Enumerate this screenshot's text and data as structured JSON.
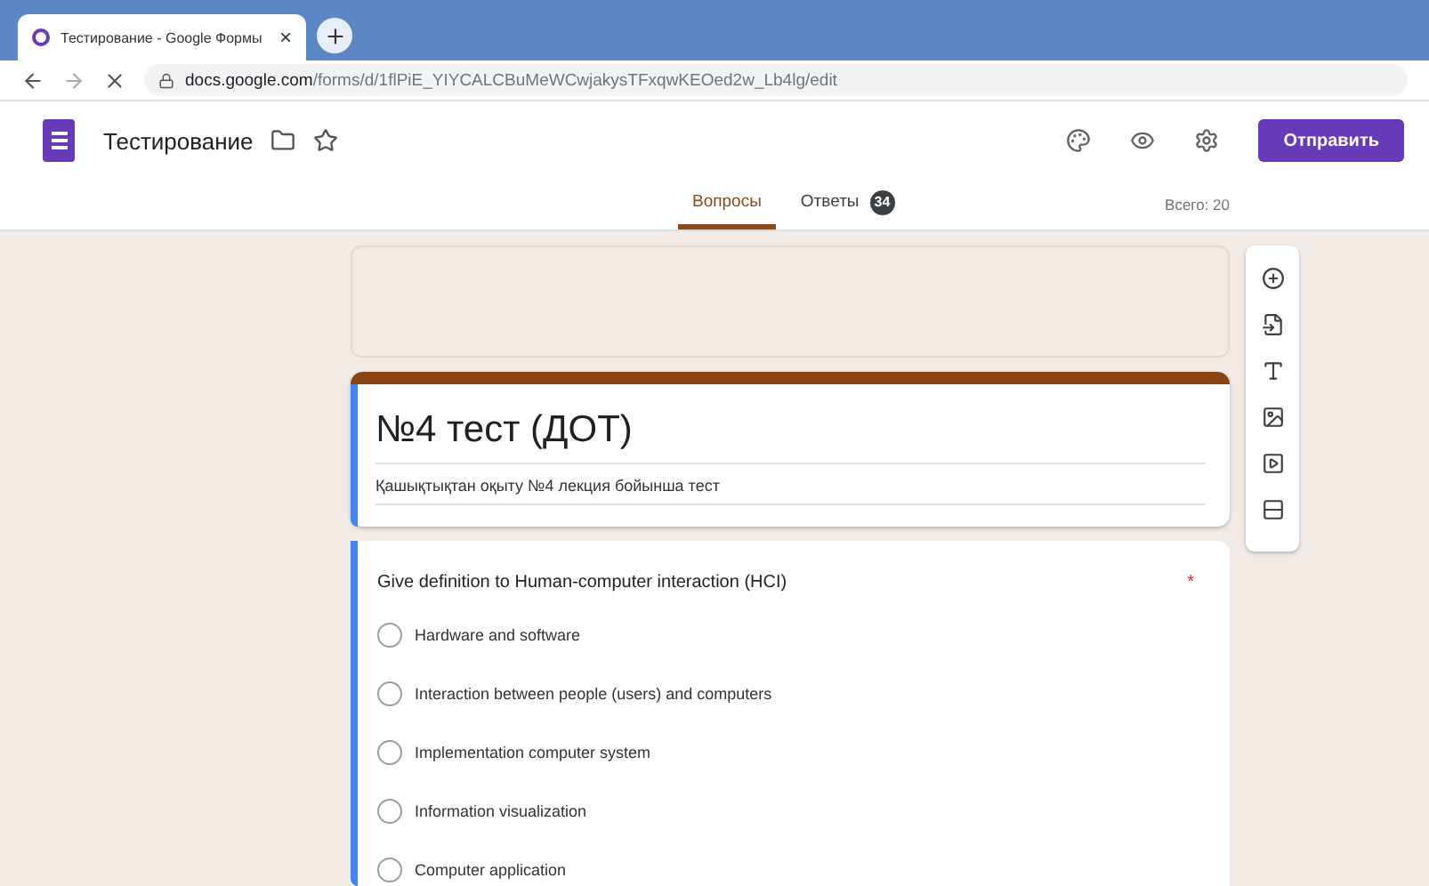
{
  "browser": {
    "tab_title": "Тестирование - Google Формы",
    "tab_close": "×",
    "url_host": "docs.google.com",
    "url_path": "/forms/d/1flPiE_YIYCALCBuMeWCwjakysTFxqwKEOed2w_Lb4lg/edit"
  },
  "header": {
    "title": "Тестирование",
    "send_button": "Отправить"
  },
  "tabs": [
    {
      "label": "Вопросы",
      "selected": true
    },
    {
      "label": "Ответы",
      "selected": false,
      "badge": "34"
    }
  ],
  "total": "Всего: 20",
  "form": {
    "title": "№4 тест (ДОТ)",
    "description": "Қашықтықтан оқыту №4 лекция бойынша тест"
  },
  "question": {
    "text": "Give definition to Human-computer interaction (HCI)",
    "required_mark": "*",
    "options": [
      {
        "label": "Hardware and software",
        "selected": false
      },
      {
        "label": "Interaction between people (users) and computers",
        "selected": false
      },
      {
        "label": "Implementation computer system",
        "selected": false
      },
      {
        "label": "Information visualization",
        "selected": false
      },
      {
        "label": "Computer application",
        "selected": false
      }
    ]
  }
}
